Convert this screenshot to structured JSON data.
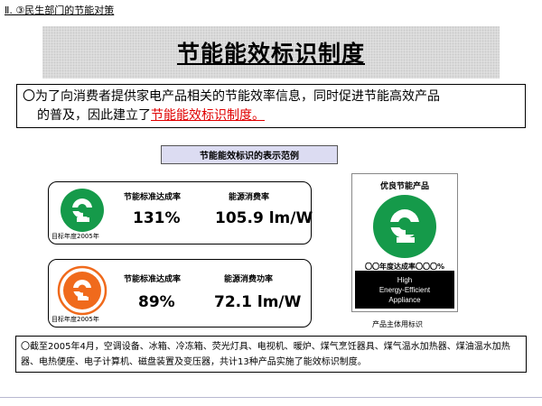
{
  "header": {
    "section_label": "Ⅱ. ③民生部门的节能对策"
  },
  "title": {
    "text": "节能能效标识制度"
  },
  "intro": {
    "line1": "〇为了向消费者提供家电产品相关的节能效率信息，同时促进节能高效产品",
    "line2_prefix": "的普及，因此建立了",
    "line2_highlight": "节能能效标识制度。"
  },
  "caption": {
    "text": "节能能效标识的表示范例"
  },
  "examples": [
    {
      "logo_color": "#159a4a",
      "standard_label": "节能标准达成率",
      "standard_value": "131%",
      "efficiency_label": "能源消费率",
      "efficiency_value": "105.9 lm/W",
      "target_year": "目标年度2005年"
    },
    {
      "logo_color": "#f06a1c",
      "standard_label": "节能标准达成率",
      "standard_value": "89%",
      "efficiency_label": "能源消费功率",
      "efficiency_value": "72.1 lm/W",
      "target_year": "目标年度2005年"
    }
  ],
  "mark": {
    "title": "优良节能产品",
    "logo_color": "#159a4a",
    "year_text": "〇〇年度达成率〇〇〇%",
    "english_lines": [
      "High",
      "Energy-Efficient",
      "Appliance"
    ],
    "caption": "产品主体用标识"
  },
  "note": {
    "text": "〇截至2005年4月，空调设备、冰箱、冷冻箱、荧光灯具、电视机、暖炉、煤气烹饪器具、煤气温水加热器、煤油温水加热器、电热便座、电子计算机、磁盘装置及变压器，共计13种产品实施了能效标识制度。"
  }
}
